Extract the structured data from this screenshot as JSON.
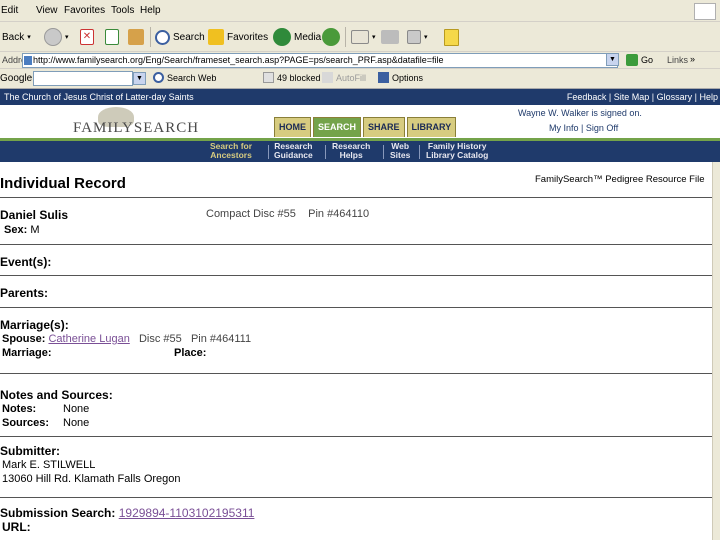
{
  "menu": [
    "Edit",
    "View",
    "Favorites",
    "Tools",
    "Help"
  ],
  "toolbar": {
    "back": "Back",
    "search": "Search",
    "favorites": "Favorites",
    "media": "Media"
  },
  "address": {
    "label": "Address",
    "url": "http://www.familysearch.org/Eng/Search/frameset_search.asp?PAGE=ps/search_PRF.asp&datafile=file",
    "go": "Go",
    "links": "Links"
  },
  "google_bar": {
    "logo": "Google",
    "search_web": "Search Web",
    "blocked": "49 blocked",
    "autofill": "AutoFill",
    "options": "Options"
  },
  "site": {
    "church": "The Church of Jesus Christ of Latter-day Saints",
    "top_links": [
      "Feedback",
      "Site Map",
      "Glossary",
      "Help"
    ],
    "logo": "FAMILYSEARCH",
    "tabs": [
      "HOME",
      "SEARCH",
      "SHARE",
      "LIBRARY"
    ],
    "active_tab": "SEARCH",
    "signed_in": "Wayne W. Walker is signed on.",
    "my_links": [
      "My Info",
      "Sign Off"
    ],
    "subnav": [
      {
        "l1": "Search for",
        "l2": "Ancestors"
      },
      {
        "l1": "Research",
        "l2": "Guidance"
      },
      {
        "l1": "Research",
        "l2": "Helps"
      },
      {
        "l1": "Web",
        "l2": "Sites"
      },
      {
        "l1": "Family History",
        "l2": "Library Catalog"
      }
    ]
  },
  "record": {
    "title": "Individual Record",
    "resource": "FamilySearch™ Pedigree Resource File",
    "name": "Daniel Sulis",
    "compact_disc": "Compact Disc #55",
    "pin": "Pin #464110",
    "sex_label": "Sex:",
    "sex": "M",
    "events": "Event(s):",
    "parents": "Parents:",
    "marriages": "Marriage(s):",
    "spouse_label": "Spouse:",
    "spouse": "Catherine Lugan",
    "spouse_disc": "Disc #55",
    "spouse_pin": "Pin #464111",
    "marriage_label": "Marriage:",
    "place_label": "Place:",
    "notes_header": "Notes and Sources:",
    "notes_label": "Notes:",
    "notes": "None",
    "sources_label": "Sources:",
    "sources": "None",
    "submitter_header": "Submitter:",
    "submitter_name": "Mark E. STILWELL",
    "submitter_addr": "13060 Hill Rd. Klamath Falls Oregon",
    "submission_label": "Submission Search:",
    "submission_id": "1929894-1103102195311",
    "url_label": "URL:"
  }
}
